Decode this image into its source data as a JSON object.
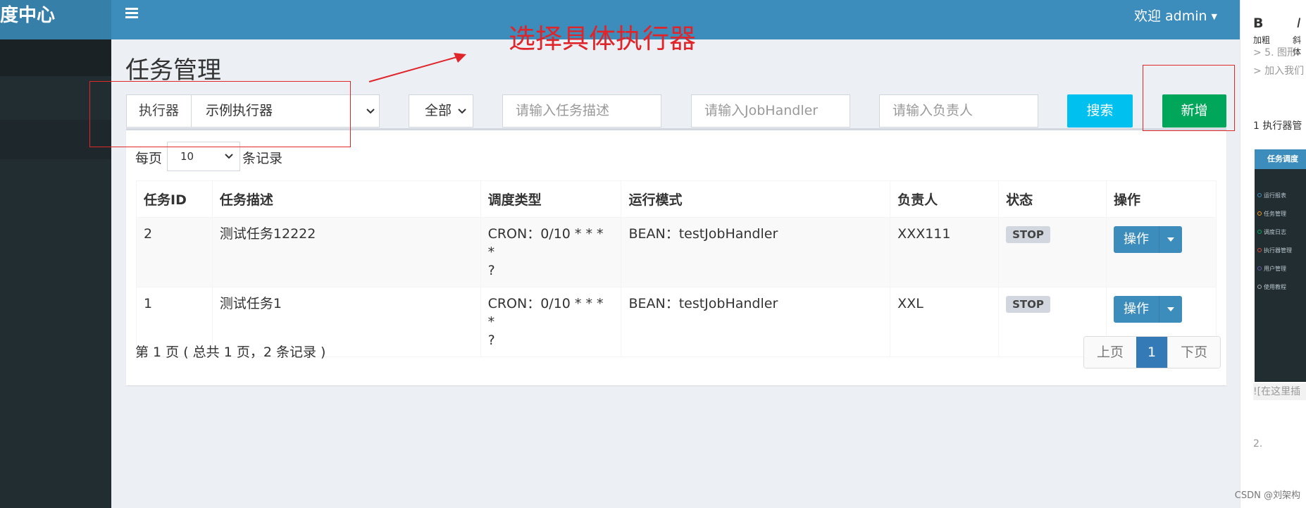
{
  "sidebar": {
    "logo_text": "度中心"
  },
  "header": {
    "menu_icon": "hamburger-icon",
    "user_label": "欢迎 admin"
  },
  "page": {
    "title": "任务管理"
  },
  "filters": {
    "executor_label": "执行器",
    "executor_value": "示例执行器",
    "status_value": "全部",
    "job_desc_placeholder": "请输入任务描述",
    "job_handler_placeholder": "请输入JobHandler",
    "author_placeholder": "请输入负责人",
    "search_label": "搜索",
    "add_label": "新增"
  },
  "table": {
    "length_prefix": "每页",
    "length_value": "10",
    "length_suffix": "条记录",
    "columns": [
      "任务ID",
      "任务描述",
      "调度类型",
      "运行模式",
      "负责人",
      "状态",
      "操作"
    ],
    "rows": [
      {
        "id": "2",
        "desc": "测试任务12222",
        "schedule_line1": "CRON：0/10 * * * *",
        "schedule_line2": "?",
        "mode": "BEAN：testJobHandler",
        "author": "XXX111",
        "status": "STOP",
        "action": "操作"
      },
      {
        "id": "1",
        "desc": "测试任务1",
        "schedule_line1": "CRON：0/10 * * * *",
        "schedule_line2": "?",
        "mode": "BEAN：testJobHandler",
        "author": "XXL",
        "status": "STOP",
        "action": "操作"
      }
    ],
    "info": "第 1 页 ( 总共 1 页，2 条记录 )",
    "pager": {
      "prev": "上页",
      "current": "1",
      "next": "下页"
    }
  },
  "annotation": {
    "text": "选择具体执行器",
    "color": "#e0252a"
  },
  "right_panel": {
    "bold": "B",
    "bold_label": "加粗",
    "italic": "I",
    "italic_label": "斜体",
    "line_a": "> 5. 图形",
    "line_b": "> 加入我们",
    "line_c": "1  执行器管",
    "thumb_header": "任务调度",
    "thumb_items": [
      "运行报表",
      "任务管理",
      "调度日志",
      "执行器管理",
      "用户管理",
      "使用教程"
    ],
    "input_hint": "![在这里插",
    "list_num": "2.",
    "watermark": "CSDN @刘架构"
  },
  "colors": {
    "navbar": "#3c8dbc",
    "sidebar": "#222d32",
    "search": "#00c0ef",
    "add": "#00a65a",
    "primary": "#3c8dbc"
  }
}
